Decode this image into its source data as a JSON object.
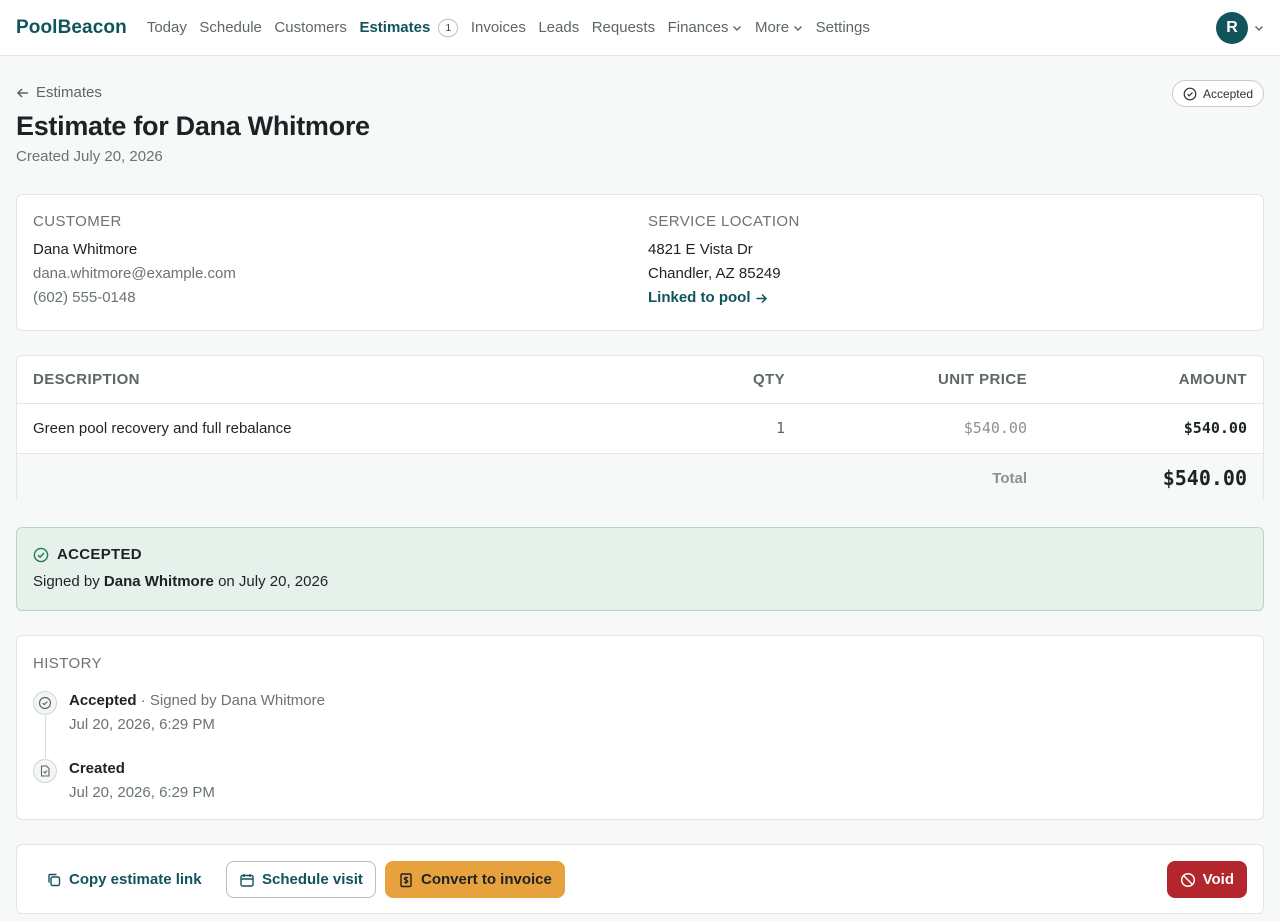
{
  "app": {
    "brand": "PoolBeacon"
  },
  "nav": {
    "items": [
      {
        "label": "Today"
      },
      {
        "label": "Schedule"
      },
      {
        "label": "Customers"
      },
      {
        "label": "Estimates",
        "badge": "1",
        "active": true
      },
      {
        "label": "Invoices"
      },
      {
        "label": "Leads"
      },
      {
        "label": "Requests"
      },
      {
        "label": "Finances",
        "dropdown": true
      },
      {
        "label": "More",
        "dropdown": true
      },
      {
        "label": "Settings"
      }
    ],
    "user_initial": "R"
  },
  "header": {
    "back_label": "Estimates",
    "status": "Accepted",
    "title": "Estimate for Dana Whitmore",
    "created": "Created July 20, 2026"
  },
  "customer": {
    "heading": "CUSTOMER",
    "name": "Dana Whitmore",
    "email": "dana.whitmore@example.com",
    "phone": "(602) 555-0148"
  },
  "location": {
    "heading": "SERVICE LOCATION",
    "line1": "4821 E Vista Dr",
    "line2": "Chandler, AZ 85249",
    "link": "Linked to pool"
  },
  "line_items": {
    "headers": {
      "description": "DESCRIPTION",
      "qty": "QTY",
      "unit_price": "UNIT PRICE",
      "amount": "AMOUNT"
    },
    "rows": [
      {
        "description": "Green pool recovery and full rebalance",
        "qty": "1",
        "unit_price": "$540.00",
        "amount": "$540.00"
      }
    ],
    "total_label": "Total",
    "total": "$540.00"
  },
  "acceptance": {
    "heading": "ACCEPTED",
    "prefix": "Signed by",
    "signer": "Dana Whitmore",
    "suffix": "on July 20, 2026"
  },
  "history": {
    "heading": "HISTORY",
    "entries": [
      {
        "title": "Accepted",
        "detail": "· Signed by Dana Whitmore",
        "time": "Jul 20, 2026, 6:29 PM",
        "icon": "check-circle-icon"
      },
      {
        "title": "Created",
        "detail": "",
        "time": "Jul 20, 2026, 6:29 PM",
        "icon": "document-icon"
      }
    ]
  },
  "actions": {
    "copy_link": "Copy estimate link",
    "schedule_visit": "Schedule visit",
    "convert_invoice": "Convert to invoice",
    "void": "Void"
  },
  "colors": {
    "brand": "#12545c",
    "accent": "#e8a23d",
    "danger": "#b3262b",
    "success_bg": "#e6f1ec"
  }
}
